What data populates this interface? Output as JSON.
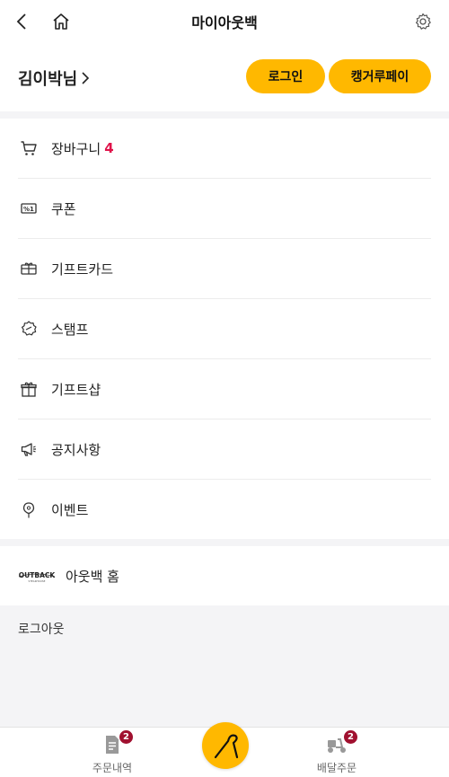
{
  "header": {
    "title": "마이아웃백",
    "back_icon": "chevron-left-icon",
    "home_icon": "home-icon",
    "settings_icon": "gear-icon"
  },
  "profile": {
    "user_name": "김이박님",
    "login_label": "로그인",
    "pay_label": "캥거루페이",
    "accent_color": "#ffb800"
  },
  "menu": {
    "items": [
      {
        "label": "장바구니",
        "count": "4",
        "icon": "cart-icon"
      },
      {
        "label": "쿠폰",
        "icon": "coupon-icon"
      },
      {
        "label": "기프트카드",
        "icon": "gift-card-icon"
      },
      {
        "label": "스탬프",
        "icon": "stamp-icon"
      },
      {
        "label": "기프트샵",
        "icon": "gift-icon"
      },
      {
        "label": "공지사항",
        "icon": "megaphone-icon"
      },
      {
        "label": "이벤트",
        "icon": "balloon-icon"
      }
    ]
  },
  "outback": {
    "logo_text": "OUTBACK",
    "logo_subtext": "STEAKHOUSE",
    "label": "아웃백 홈"
  },
  "logout_label": "로그아웃",
  "tabbar": {
    "orders": {
      "label": "주문내역",
      "badge": "2",
      "icon": "receipt-icon"
    },
    "center": {
      "icon": "boomerang-icon"
    },
    "delivery": {
      "label": "배달주문",
      "badge": "2",
      "icon": "scooter-icon"
    }
  },
  "colors": {
    "accent": "#ffb800",
    "count_red": "#e0124a",
    "badge": "#a0102f",
    "divider_band": "#f4f4f6"
  }
}
